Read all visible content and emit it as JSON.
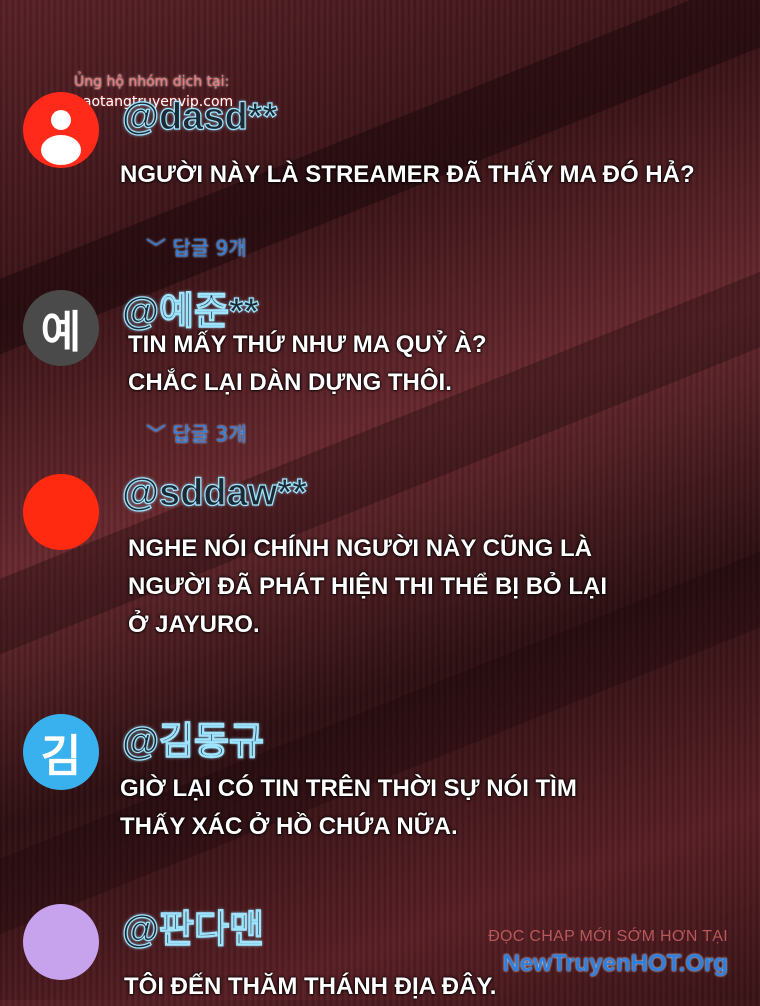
{
  "watermark_top": {
    "line1": "Ủng hộ nhóm dịch tại:",
    "line2": "baotangtruyenvip.com"
  },
  "comments": [
    {
      "avatar_letter": "",
      "avatar_icon": "person-icon",
      "avatar_color": "#ff2a1a",
      "username": "@dasd**",
      "text": "NGƯỜI NÀY LÀ STREAMER ĐÃ THẤY MA ĐÓ HẢ?",
      "replies": "﹀ 답글 9개"
    },
    {
      "avatar_letter": "예",
      "avatar_color": "#4a4a4a",
      "username": "@예준**",
      "text": "TIN MẤY THỨ NHƯ MA QUỶ À?\nCHẮC LẠI DÀN DỰNG THÔI.",
      "replies": "﹀ 답글 3개"
    },
    {
      "avatar_letter": "",
      "avatar_color": "#ff2a10",
      "username": "@sddaw**",
      "text": "NGHE NÓI CHÍNH NGƯỜI NÀY CŨNG LÀ\nNGƯỜI ĐÃ PHÁT HIỆN THI THỂ BỊ BỎ LẠI\n Ở JAYURO.",
      "replies": ""
    },
    {
      "avatar_letter": "김",
      "avatar_color": "#39b1ee",
      "username": "@김동규",
      "text": "GIỜ LẠI CÓ TIN TRÊN THỜI SỰ NÓI TÌM\nTHẤY XÁC Ở HỒ CHỨA NỮA.",
      "replies": ""
    },
    {
      "avatar_letter": "",
      "avatar_color": "#c7a3ee",
      "username": "@판다맨",
      "text": "TÔI ĐẾN THĂM THÁNH ĐỊA ĐÂY.",
      "replies": ""
    }
  ],
  "watermark_bottom": {
    "line1": "ĐỌC CHAP MỚI SỚM HƠN TẠI",
    "line2": "NewTruyenHOT.Org"
  }
}
